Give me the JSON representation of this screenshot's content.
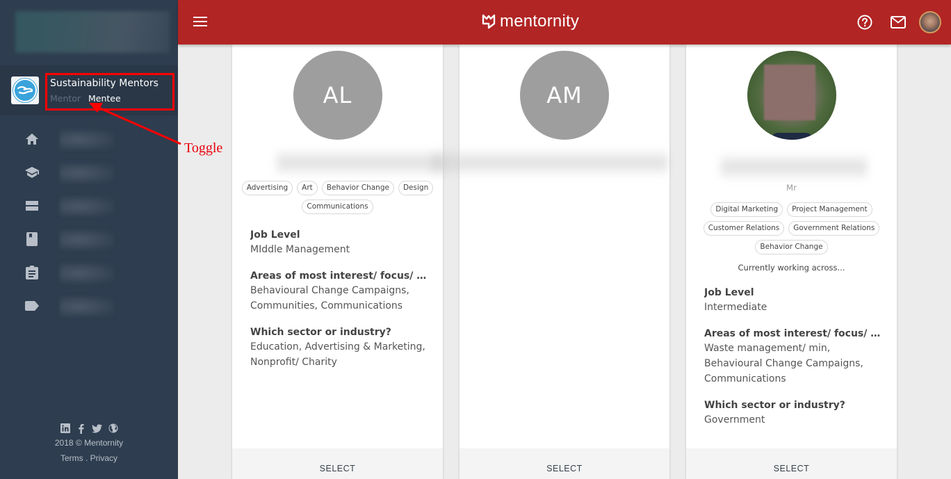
{
  "sidebar": {
    "organization": {
      "name": "Sustainability Mentors",
      "roles": [
        "Mentor",
        "Mentee"
      ],
      "active_role": "Mentee"
    },
    "nav_icons": [
      "home-icon",
      "school-icon",
      "list-icon",
      "book-icon",
      "assignment-icon",
      "label-icon"
    ],
    "footer": {
      "social_icons": [
        "linkedin-icon",
        "facebook-icon",
        "twitter-icon",
        "globe-icon"
      ],
      "copyright": "2018 © Mentornity",
      "terms": "Terms",
      "separator": " . ",
      "privacy": "Privacy"
    }
  },
  "topbar": {
    "brand": "mentornity",
    "icons": [
      "help-icon",
      "mail-icon",
      "user-avatar"
    ]
  },
  "cards": [
    {
      "initials": "AL",
      "tags": [
        "Advertising",
        "Art",
        "Behavior Change",
        "Design",
        "Communications"
      ],
      "fields": [
        {
          "label": "Job Level",
          "value": "MIddle Management"
        },
        {
          "label": "Areas of most interest/ focus/ ex...",
          "value": "Behavioural Change Campaigns, Communities, Communications"
        },
        {
          "label": "Which sector or industry?",
          "value": "Education, Advertising & Marketing, Nonprofit/ Charity"
        }
      ],
      "action": "SELECT"
    },
    {
      "initials": "AM",
      "tags": [],
      "fields": [],
      "action": "SELECT"
    },
    {
      "initials": "",
      "title": "Mr",
      "tags": [
        "Digital Marketing",
        "Project Management",
        "Customer Relations",
        "Government Relations",
        "Behavior Change"
      ],
      "blurb": "Currently working across...",
      "fields": [
        {
          "label": "Job Level",
          "value": "Intermediate"
        },
        {
          "label": "Areas of most interest/ focus/ ex...",
          "value": "Waste management/ min, Behavioural Change Campaigns, Communications"
        },
        {
          "label": "Which sector or industry?",
          "value": "Government"
        }
      ],
      "action": "SELECT"
    }
  ],
  "annotation": {
    "label": "Toggle",
    "color": "#ff0000"
  },
  "colors": {
    "brand_red": "#b12524",
    "sidebar_bg": "#2e3d4f",
    "avatar_grey": "#9e9e9e"
  }
}
